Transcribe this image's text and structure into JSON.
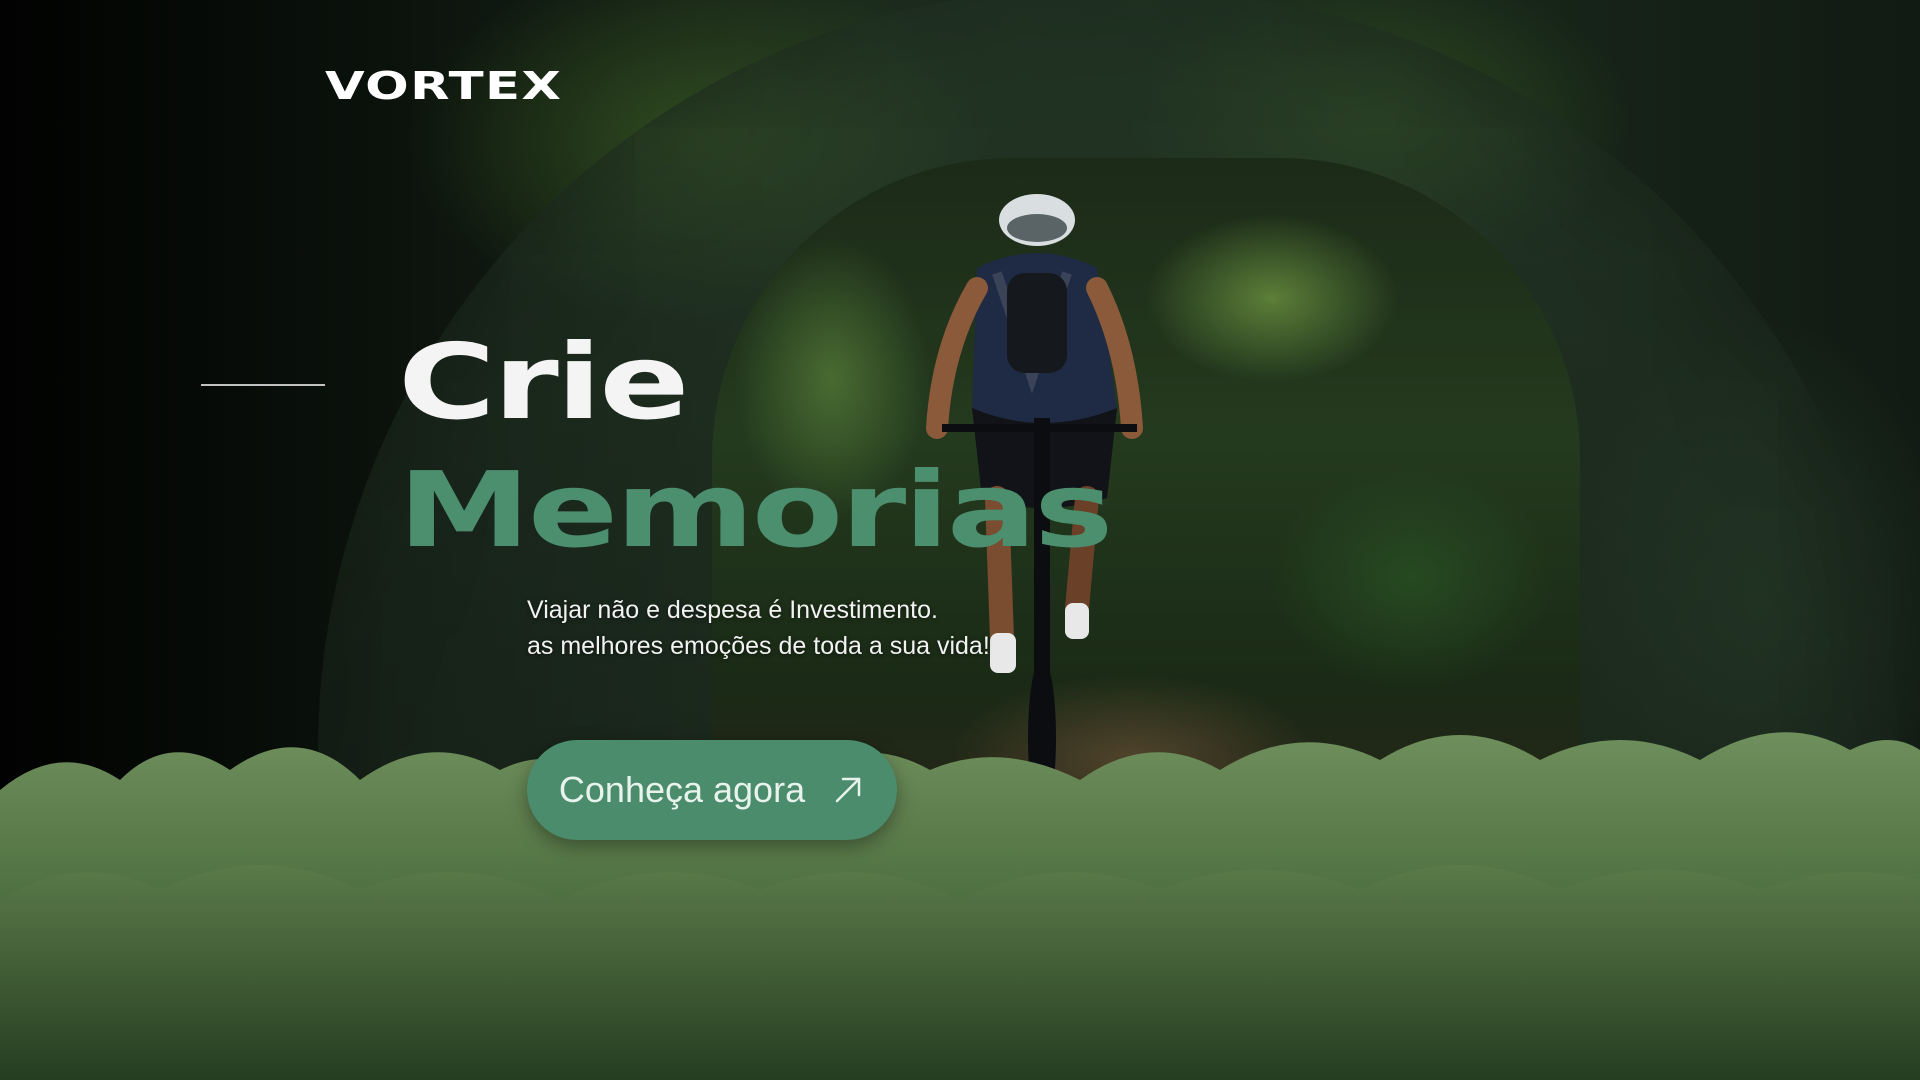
{
  "brand": {
    "logo": "VORTEX"
  },
  "hero": {
    "title_line1": "Crie",
    "title_line2": "Memorias",
    "subtitle_line1": "Viajar não e despesa é Investimento.",
    "subtitle_line2": "as melhores emoções de toda a sua vida!"
  },
  "cta": {
    "label": "Conheça agora",
    "icon": "arrow-up-right-icon"
  },
  "colors": {
    "accent_green": "#4c8f6e",
    "title_white": "#f4f4f4",
    "button_bg": "#4b8c6d"
  }
}
